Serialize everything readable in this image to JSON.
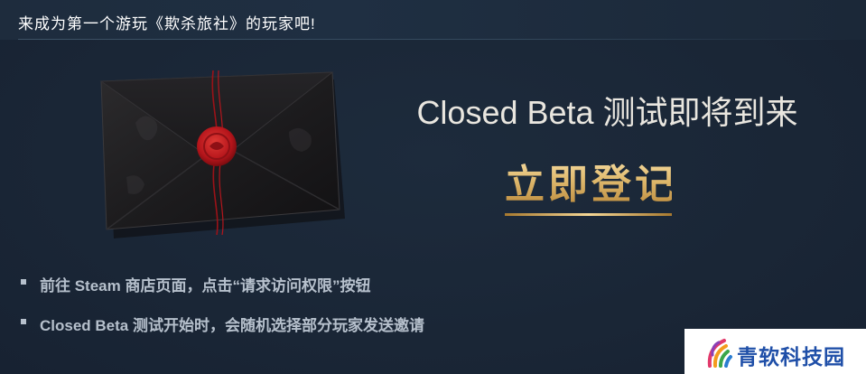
{
  "header": {
    "title": "来成为第一个游玩《欺杀旅社》的玩家吧!"
  },
  "promo": {
    "headline": "Closed Beta 测试即将到来",
    "register_label": "立即登记"
  },
  "steps": [
    {
      "text": "前往 Steam 商店页面，点击“请求访问权限”按钮"
    },
    {
      "text": "Closed Beta 测试开始时，会随机选择部分玩家发送邀请"
    }
  ],
  "watermark": {
    "text": "青软科技园"
  },
  "colors": {
    "background": "#1b2838",
    "header_text": "#ffffff",
    "headline": "#e9e6df",
    "gold": "#d8b168",
    "bullet_text": "#b6c0cc",
    "wax_seal": "#c4161c",
    "watermark_text": "#1f4fa8"
  },
  "icons": {
    "envelope": "sealed-envelope-icon",
    "seal": "wax-seal-icon",
    "bullet": "square-bullet-icon",
    "watermark_logo": "colorful-arc-logo-icon"
  }
}
